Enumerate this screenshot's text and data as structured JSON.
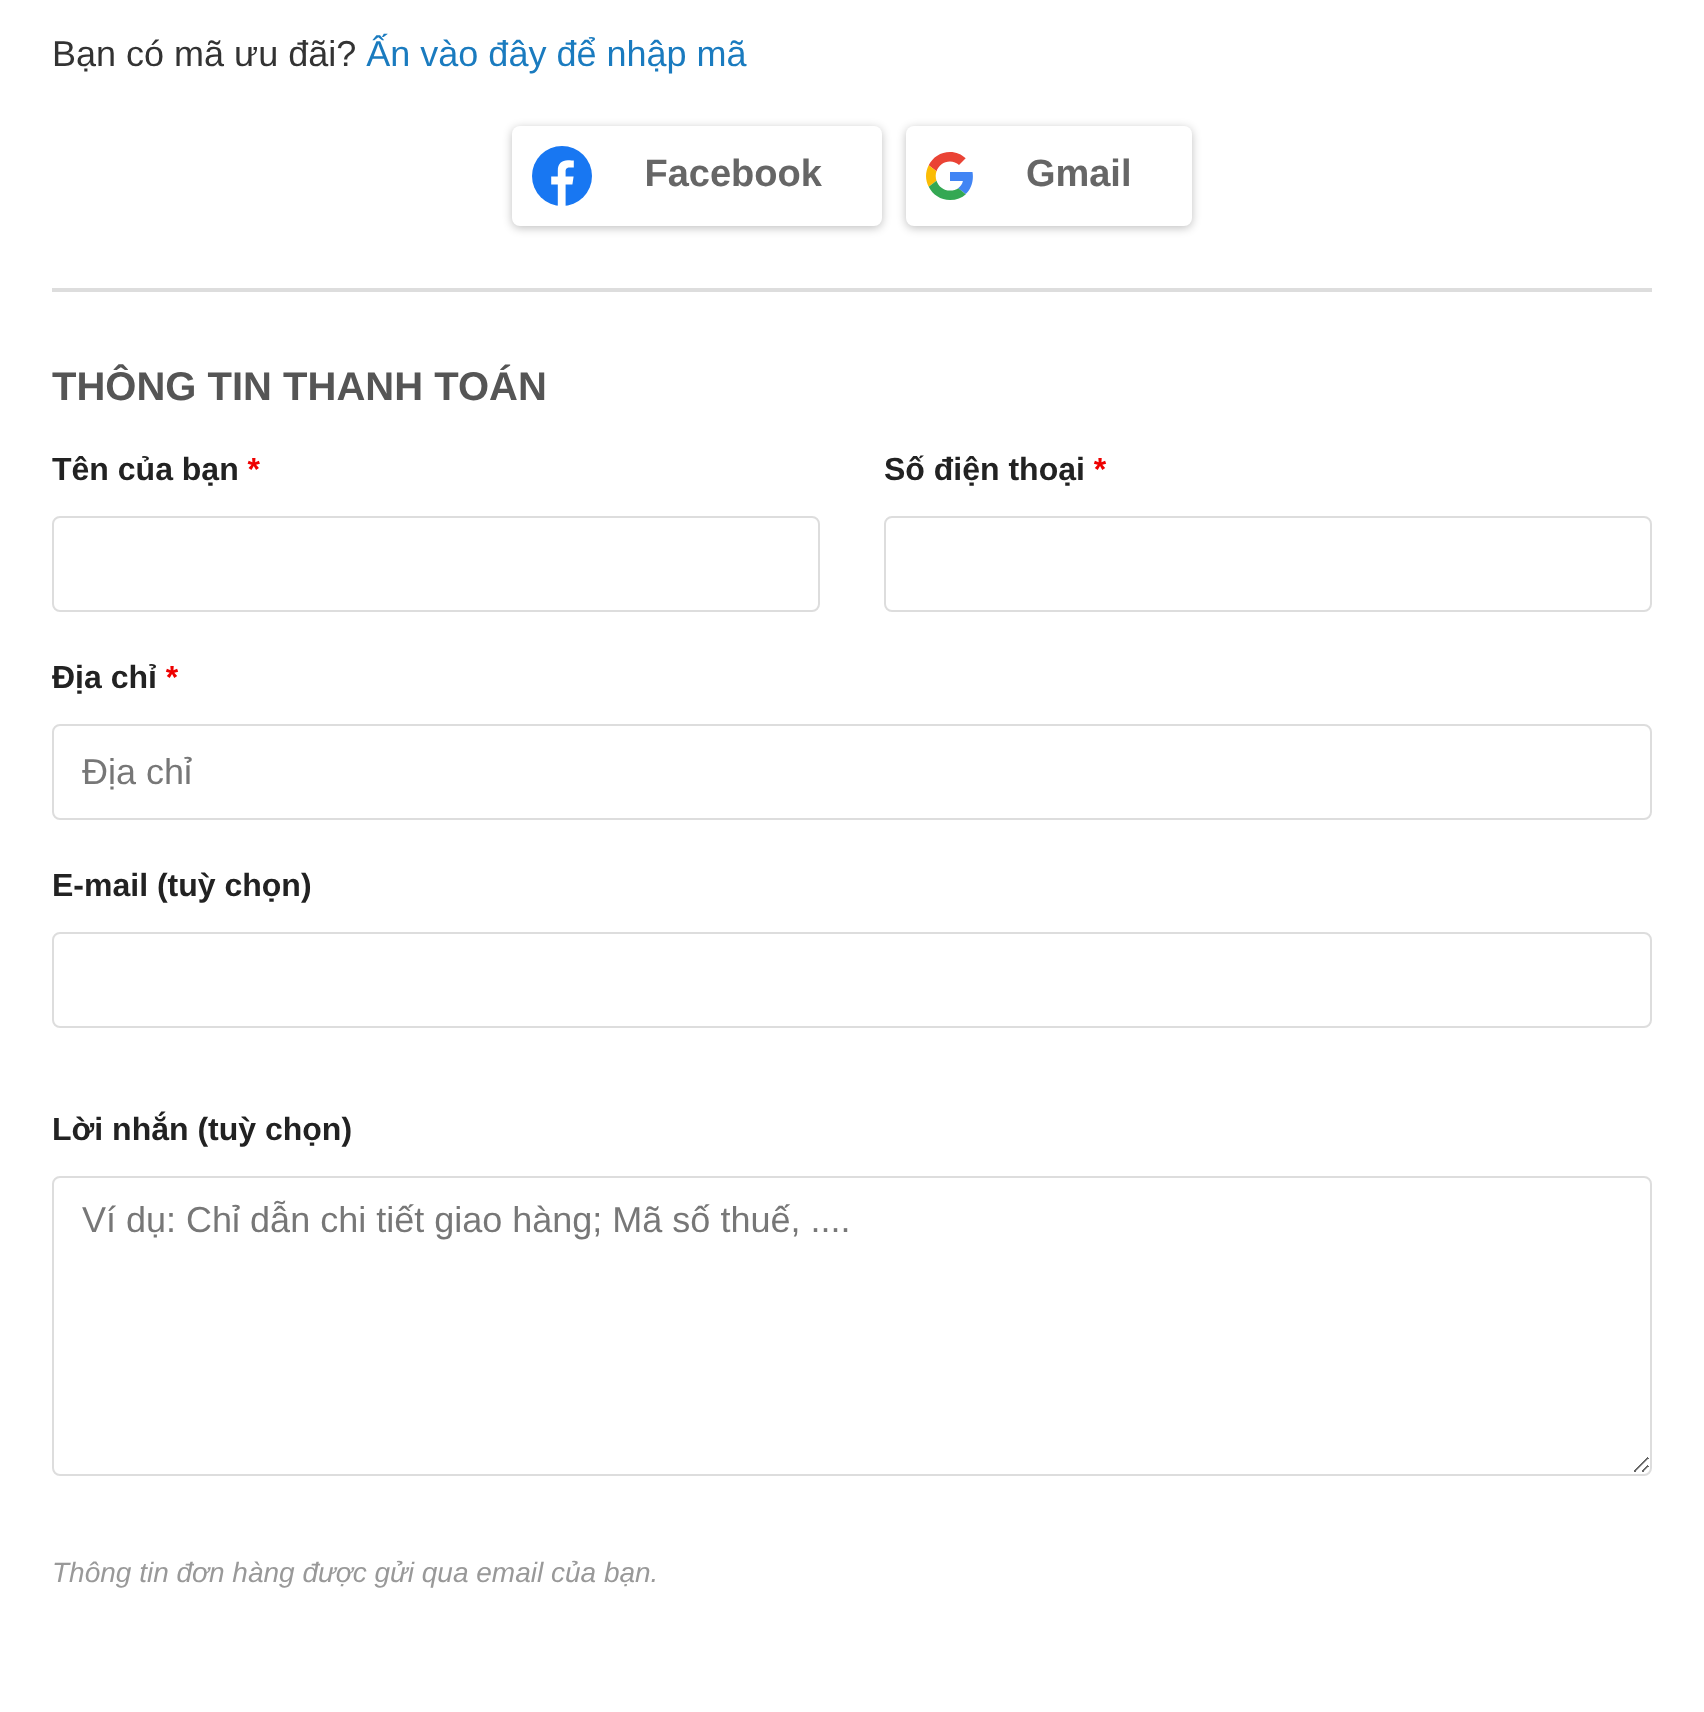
{
  "coupon": {
    "text": "Bạn có mã ưu đãi?",
    "link": "Ấn vào đây để nhập mã"
  },
  "social_buttons": [
    {
      "kind": "facebook",
      "label": "Facebook"
    },
    {
      "kind": "google",
      "label": "Gmail"
    }
  ],
  "section_title": "THÔNG TIN THANH TOÁN",
  "rows": [
    [
      {
        "kind": "input",
        "label": "Tên của bạn",
        "required": true,
        "required_mark": "*"
      },
      {
        "kind": "input",
        "label": "Số điện thoại",
        "required": true,
        "required_mark": "*"
      }
    ],
    [
      {
        "kind": "input",
        "label": "Địa chỉ",
        "required": true,
        "required_mark": "*",
        "placeholder": "Địa chỉ"
      }
    ],
    [
      {
        "kind": "input",
        "label": "E-mail (tuỳ chọn)",
        "required": false
      }
    ],
    [
      {
        "kind": "textarea",
        "label": "Lời nhắn (tuỳ chọn)",
        "required": false,
        "placeholder": "Ví dụ: Chỉ dẫn chi tiết giao hàng; Mã số thuế, ...."
      }
    ]
  ],
  "note": "Thông tin đơn hàng được gửi qua email của bạn."
}
